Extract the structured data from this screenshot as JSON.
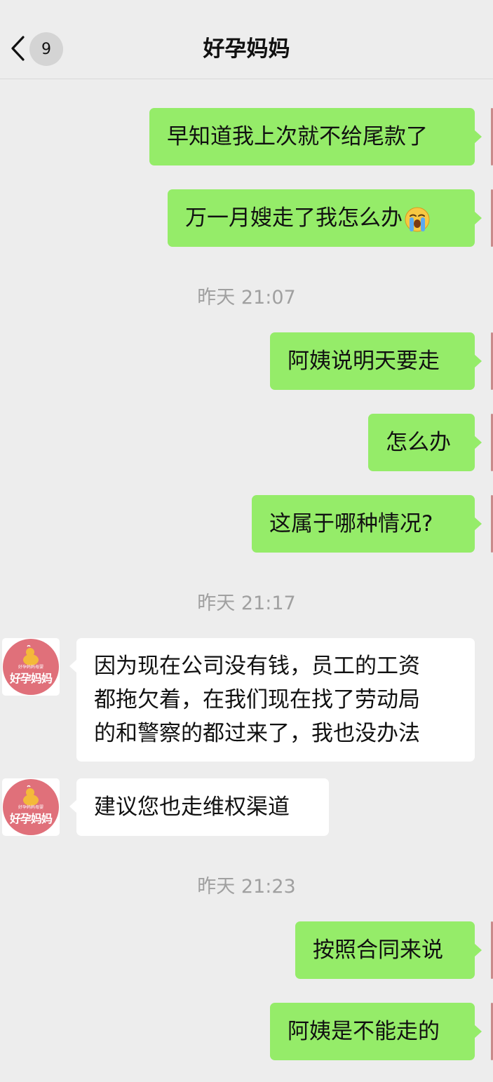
{
  "header": {
    "back_icon": "chevron-left-icon",
    "unread_count": "9",
    "title": "好孕妈妈"
  },
  "colors": {
    "background": "#ededed",
    "outgoing_bubble": "#95ec69",
    "incoming_bubble": "#ffffff",
    "avatar": "#e0707a"
  },
  "messages": [
    {
      "type": "outgoing",
      "text": "早知道我上次就不给尾款了"
    },
    {
      "type": "outgoing",
      "text": "万一月嫂走了我怎么办",
      "emoji": "loudly-crying-face"
    },
    {
      "type": "time",
      "text": "昨天 21:07"
    },
    {
      "type": "outgoing",
      "text": "阿姨说明天要走"
    },
    {
      "type": "outgoing",
      "text": "怎么办"
    },
    {
      "type": "outgoing",
      "text": "这属于哪种情况?"
    },
    {
      "type": "time",
      "text": "昨天 21:17"
    },
    {
      "type": "incoming",
      "sender": "好孕妈妈",
      "lines": [
        "因为现在公司没有钱，员工的工资",
        "都拖欠着，在我们现在找了劳动局",
        "的和警察的都过来了，我也没办法"
      ]
    },
    {
      "type": "incoming",
      "sender": "好孕妈妈",
      "text": "建议您也走维权渠道"
    },
    {
      "type": "time",
      "text": "昨天 21:23"
    },
    {
      "type": "outgoing",
      "text": "按照合同来说"
    },
    {
      "type": "outgoing",
      "text": "阿姨是不能走的"
    }
  ],
  "avatar": {
    "logo_text": "好孕妈妈",
    "tagline": "好孕妈妈母婴"
  }
}
